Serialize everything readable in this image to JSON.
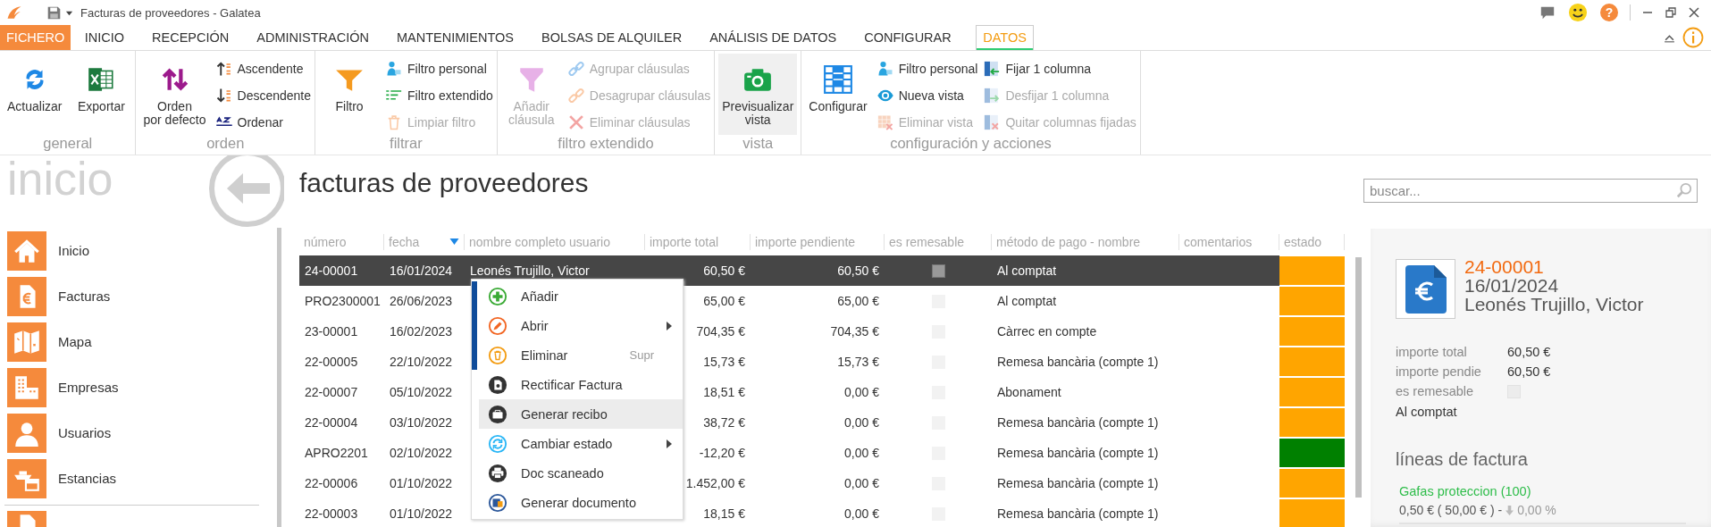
{
  "title_bar": {
    "title": "Facturas de proveedores - Galatea",
    "help_label": "?"
  },
  "menu_tabs": [
    {
      "label": "FICHERO",
      "kind": "file",
      "selected": false
    },
    {
      "label": "INICIO",
      "kind": "tab",
      "selected": false
    },
    {
      "label": "RECEPCIÓN",
      "kind": "tab",
      "selected": false
    },
    {
      "label": "ADMINISTRACIÓN",
      "kind": "tab",
      "selected": false
    },
    {
      "label": "MANTENIMIENTOS",
      "kind": "tab",
      "selected": false
    },
    {
      "label": "BOLSAS DE ALQUILER",
      "kind": "tab",
      "selected": false
    },
    {
      "label": "ANÁLISIS DE DATOS",
      "kind": "tab",
      "selected": false
    },
    {
      "label": "CONFIGURAR",
      "kind": "tab",
      "selected": false
    },
    {
      "label": "DATOS",
      "kind": "tab",
      "selected": true
    }
  ],
  "ribbon": {
    "groups": [
      {
        "label": "general",
        "large": [
          {
            "lines": [
              "Actualizar"
            ],
            "disabled": false,
            "pressed": false
          },
          {
            "lines": [
              "Exportar"
            ],
            "disabled": false,
            "pressed": false
          }
        ]
      },
      {
        "label": "orden",
        "large": [
          {
            "lines": [
              "Orden",
              "por defecto"
            ],
            "disabled": false,
            "pressed": false
          }
        ],
        "small": [
          {
            "label": "Ascendente",
            "disabled": false
          },
          {
            "label": "Descendente",
            "disabled": false
          },
          {
            "label": "Ordenar",
            "disabled": false
          }
        ]
      },
      {
        "label": "filtrar",
        "large": [
          {
            "lines": [
              "Filtro"
            ],
            "disabled": false,
            "pressed": false
          }
        ],
        "small": [
          {
            "label": "Filtro personal",
            "disabled": false
          },
          {
            "label": "Filtro extendido",
            "disabled": false
          },
          {
            "label": "Limpiar filtro",
            "disabled": true
          }
        ]
      },
      {
        "label": "filtro extendido",
        "large": [
          {
            "lines": [
              "Añadir",
              "cláusula"
            ],
            "disabled": true,
            "pressed": false
          }
        ],
        "small": [
          {
            "label": "Agrupar cláusulas",
            "disabled": true
          },
          {
            "label": "Desagrupar cláusulas",
            "disabled": true
          },
          {
            "label": "Eliminar cláusulas",
            "disabled": true
          }
        ]
      },
      {
        "label": "vista",
        "large": [
          {
            "lines": [
              "Previsualizar",
              "vista"
            ],
            "disabled": false,
            "pressed": true
          }
        ]
      },
      {
        "label": "configuración y acciones",
        "large": [
          {
            "lines": [
              "Configurar"
            ],
            "disabled": false,
            "pressed": false
          }
        ],
        "small": [
          {
            "label": "Filtro personal",
            "disabled": false
          },
          {
            "label": "Nueva vista",
            "disabled": false
          },
          {
            "label": "Eliminar vista",
            "disabled": true
          },
          {
            "label": "Fijar 1 columna",
            "disabled": false
          },
          {
            "label": "Desfijar 1 columna",
            "disabled": true
          },
          {
            "label": "Quitar columnas fijadas",
            "disabled": true
          }
        ]
      }
    ]
  },
  "sidebar": {
    "title": "inicio",
    "items": [
      {
        "label": "Inicio"
      },
      {
        "label": "Facturas"
      },
      {
        "label": "Mapa"
      },
      {
        "label": "Empresas"
      },
      {
        "label": "Usuarios"
      },
      {
        "label": "Estancias"
      }
    ],
    "more_items_below": true
  },
  "page": {
    "title": "facturas de proveedores",
    "search": {
      "placeholder": "buscar..."
    }
  },
  "table": {
    "columns": [
      {
        "label": "número",
        "sorted": false
      },
      {
        "label": "fecha",
        "sorted": true
      },
      {
        "label": "nombre completo usuario",
        "sorted": false
      },
      {
        "label": "importe total",
        "sorted": false
      },
      {
        "label": "importe pendiente",
        "sorted": false
      },
      {
        "label": "es remesable",
        "sorted": false
      },
      {
        "label": "método de pago - nombre",
        "sorted": false
      },
      {
        "label": "comentarios",
        "sorted": false
      },
      {
        "label": "estado",
        "sorted": false
      }
    ],
    "rows": [
      {
        "numero": "24-00001",
        "fecha": "16/01/2024",
        "nombre": "Leonés Trujillo, Victor",
        "importe_total": "60,50 €",
        "importe_pendiente": "60,50 €",
        "es_remesable": false,
        "metodo_pago": "Al comptat",
        "color": "#ffa500",
        "selected": true
      },
      {
        "numero": "PRO2300001",
        "fecha": "26/06/2023",
        "importe_total": "65,00 €",
        "importe_pendiente": "65,00 €",
        "es_remesable": false,
        "metodo_pago": "Al comptat",
        "color": "#ffa500",
        "selected": false
      },
      {
        "numero": "23-00001",
        "fecha": "16/02/2023",
        "importe_total": "704,35 €",
        "importe_pendiente": "704,35 €",
        "es_remesable": false,
        "metodo_pago": "Càrrec en compte",
        "color": "#ffa500",
        "selected": false
      },
      {
        "numero": "22-00005",
        "fecha": "22/10/2022",
        "importe_total": "15,73 €",
        "importe_pendiente": "15,73 €",
        "es_remesable": false,
        "metodo_pago": "Remesa bancària (compte 1)",
        "color": "#ffa500",
        "selected": false
      },
      {
        "numero": "22-00007",
        "fecha": "05/10/2022",
        "importe_total": "18,51 €",
        "importe_pendiente": "0,00 €",
        "es_remesable": false,
        "metodo_pago": "Abonament",
        "color": "#ffa500",
        "selected": false
      },
      {
        "numero": "22-00004",
        "fecha": "03/10/2022",
        "importe_total": "38,72 €",
        "importe_pendiente": "0,00 €",
        "es_remesable": false,
        "metodo_pago": "Remesa bancària (compte 1)",
        "color": "#ffa500",
        "selected": false
      },
      {
        "numero": "APRO2201",
        "fecha": "02/10/2022",
        "importe_total": "-12,20 €",
        "importe_pendiente": "0,00 €",
        "es_remesable": false,
        "metodo_pago": "Remesa bancària (compte 1)",
        "color": "#008000",
        "selected": false
      },
      {
        "numero": "22-00006",
        "fecha": "01/10/2022",
        "importe_total": "1.452,00 €",
        "importe_pendiente": "0,00 €",
        "es_remesable": false,
        "metodo_pago": "Remesa bancària (compte 1)",
        "color": "#ffa500",
        "selected": false
      },
      {
        "numero": "22-00003",
        "fecha": "01/10/2022",
        "importe_total": "18,15 €",
        "importe_pendiente": "0,00 €",
        "es_remesable": false,
        "metodo_pago": "Remesa bancària (compte 1)",
        "color": "#ffa500",
        "selected": false
      }
    ]
  },
  "context_menu": {
    "items": [
      {
        "label": "Añadir",
        "submenu": false,
        "accent": true,
        "selected": false
      },
      {
        "label": "Abrir",
        "submenu": true,
        "accent": true,
        "selected": false
      },
      {
        "label": "Eliminar",
        "shortcut": "Supr",
        "submenu": false,
        "accent": true,
        "selected": false
      },
      {
        "label": "Rectificar Factura",
        "submenu": false,
        "accent": false,
        "selected": false
      },
      {
        "label": "Generar recibo",
        "submenu": false,
        "accent": false,
        "selected": true
      },
      {
        "label": "Cambiar estado",
        "submenu": true,
        "accent": false,
        "selected": false
      },
      {
        "label": "Doc scaneado",
        "submenu": false,
        "accent": false,
        "selected": false
      },
      {
        "label": "Generar documento",
        "submenu": false,
        "accent": false,
        "selected": false
      }
    ]
  },
  "detail": {
    "number": "24-00001",
    "date": "16/01/2024",
    "name": "Leonés Trujillo, Victor",
    "fields": [
      {
        "label": "importe total",
        "value": "60,50 €"
      },
      {
        "label": "importe pendie",
        "value": "60,50 €"
      }
    ],
    "remesable": {
      "label": "es remesable",
      "checked": false
    },
    "payment_method": "Al comptat",
    "lines_title": "líneas de factura",
    "lines": [
      {
        "name": "Gafas proteccion (100)",
        "amount": "0,50 € ( 50,00 € ) -",
        "discount": "0,00 %"
      }
    ]
  }
}
